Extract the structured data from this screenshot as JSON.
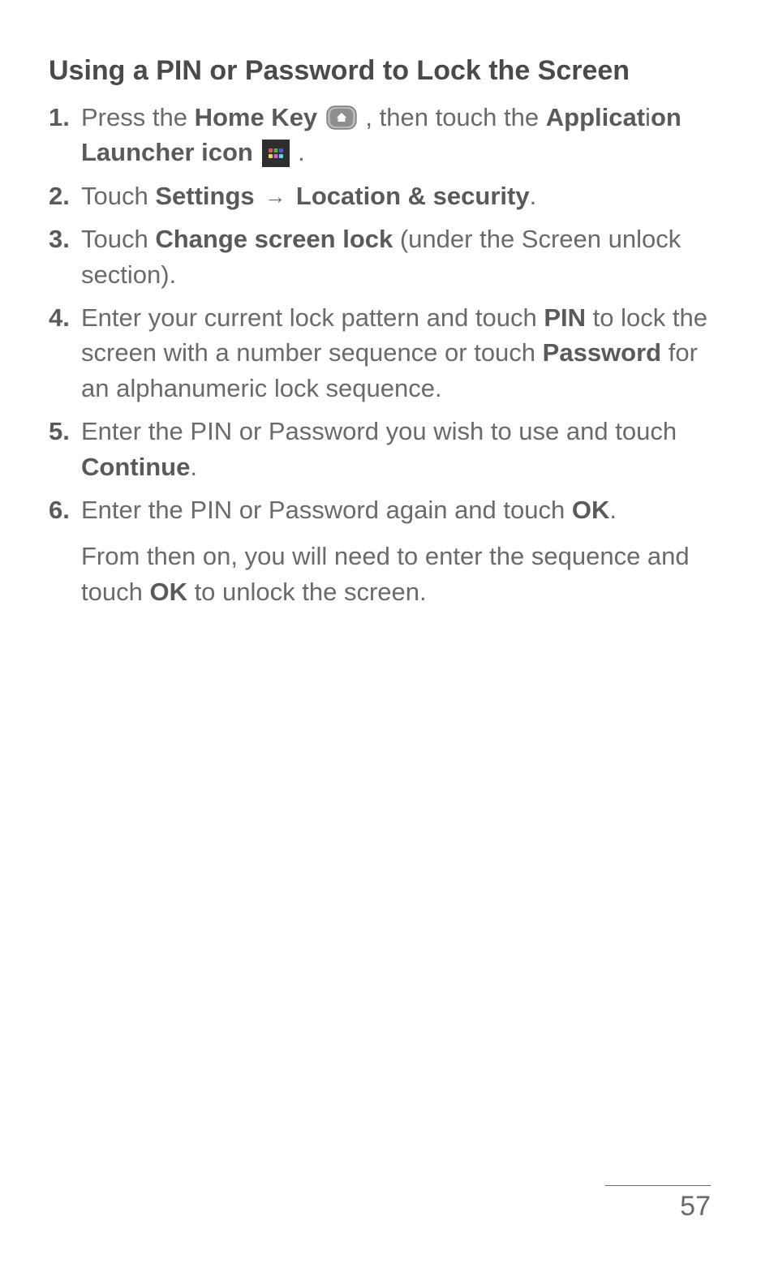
{
  "heading": "Using a PIN or Password to Lock the Screen",
  "steps": {
    "s1": {
      "num": "1.",
      "t1": "Press the ",
      "bold1": "Home Key",
      "t2": " , then touch the ",
      "bold2": "Applicat",
      "bold3": "on Launcher icon",
      "i_letter": "i",
      "t3": " ."
    },
    "s2": {
      "num": "2.",
      "t1": "Touch ",
      "bold1": "Settings",
      "arrow": "→",
      "bold2": "Location & security",
      "t2": "."
    },
    "s3": {
      "num": "3.",
      "t1": "Touch ",
      "bold1": "Change screen lock",
      "t2": " (under the Screen unlock section)."
    },
    "s4": {
      "num": "4.",
      "t1": "Enter your current lock pattern and touch ",
      "bold1": "PIN",
      "t2": " to lock the screen with a number sequence or touch ",
      "bold2": "Password",
      "t3": " for an alphanumeric lock sequence."
    },
    "s5": {
      "num": "5.",
      "t1": "Enter the PIN or Password you wish to use and touch ",
      "bold1": "Continue",
      "t2": "."
    },
    "s6": {
      "num": "6.",
      "t1": "Enter the PIN or Password again and touch ",
      "bold1": "OK",
      "t2": ".",
      "para2a": "From then on, you will need to enter the sequence and touch ",
      "bold2": "OK",
      "para2b": " to unlock the screen."
    }
  },
  "page_number": "57",
  "icons": {
    "home": "home-key-icon",
    "launcher": "app-launcher-icon"
  },
  "colors": {
    "text": "#6a6a6a",
    "bold": "#5a5a5a",
    "launcher_bg": "#2e2e2e"
  }
}
